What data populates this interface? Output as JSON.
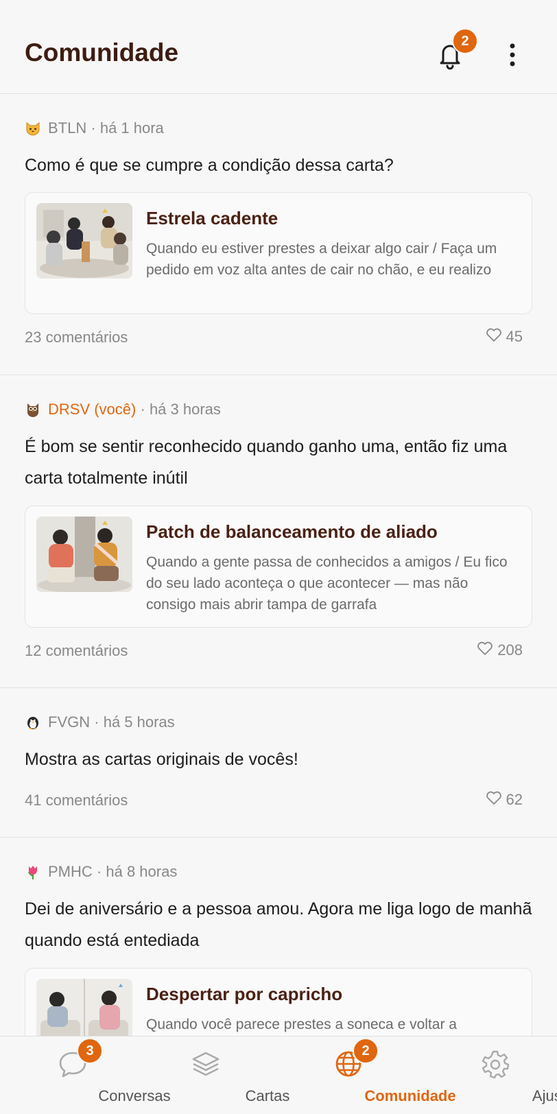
{
  "header": {
    "title": "Comunidade",
    "notifications_count": "2"
  },
  "posts": [
    {
      "avatar": "cat-face-icon",
      "user": "BTLN",
      "time": "há 1 hora",
      "text": "Como é que se cumpre a condição dessa carta?",
      "card": {
        "title": "Estrela cadente",
        "description": "Quando eu estiver prestes a deixar algo cair / Faça um pedido em voz alta antes de cair no chão, e eu realizo"
      },
      "comments": "23 comentários",
      "likes": "45"
    },
    {
      "avatar": "owl-icon",
      "user": "DRSV (você)",
      "time": "há 3 horas",
      "text": "É bom se sentir reconhecido quando ganho uma, então fiz uma carta totalmente inútil",
      "card": {
        "title": "Patch de balanceamento de aliado",
        "description": "Quando a gente passa de conhecidos a amigos / Eu fico do seu lado aconteça o que acontecer — mas não consigo mais abrir tampa de garrafa"
      },
      "comments": "12 comentários",
      "likes": "208"
    },
    {
      "avatar": "penguin-icon",
      "user": "FVGN",
      "time": "há 5 horas",
      "text": "Mostra as cartas originais de vocês!",
      "comments": "41 comentários",
      "likes": "62"
    },
    {
      "avatar": "tulip-icon",
      "user": "PMHC",
      "time": "há 8 horas",
      "text": "Dei de aniversário e a pessoa amou. Agora me liga logo de manhã quando está entediada",
      "card": {
        "title": "Despertar por capricho",
        "description": "Quando você parece prestes a soneca e voltar a"
      }
    }
  ],
  "tabbar": {
    "tabs": [
      {
        "label": "Conversas",
        "icon": "chat-bubble-icon",
        "badge": "3"
      },
      {
        "label": "Cartas",
        "icon": "layers-icon"
      },
      {
        "label": "Comunidade",
        "icon": "globe-icon",
        "badge": "2",
        "active": true
      },
      {
        "label": "Ajustes",
        "icon": "gear-icon"
      }
    ]
  },
  "colors": {
    "accent": "#e0660f",
    "title": "#3d1d12",
    "card_title": "#4a2114",
    "background": "#f7f7f7"
  },
  "separator": "·"
}
